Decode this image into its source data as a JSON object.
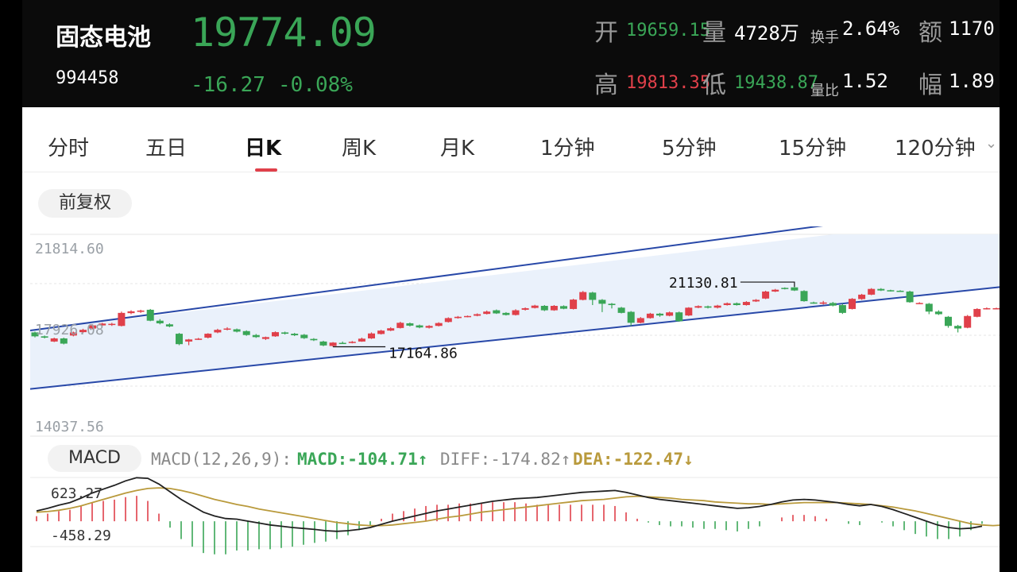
{
  "header": {
    "name": "固态电池",
    "code": "994458",
    "price": "19774.09",
    "change": "-16.27",
    "change_pct": "-0.08%",
    "open_label": "开",
    "open_value": "19659.15",
    "volume_label": "量",
    "volume_value": "4728万",
    "turnover_label": "换手",
    "turnover_value": "2.64%",
    "amount_label": "额",
    "amount_value": "1170",
    "high_label": "高",
    "high_value": "19813.35",
    "low_label": "低",
    "low_value": "19438.87",
    "vol_ratio_label": "量比",
    "vol_ratio_value": "1.52",
    "amplitude_label": "幅",
    "amplitude_value": "1.89"
  },
  "tabs": [
    "分时",
    "五日",
    "日K",
    "周K",
    "月K",
    "1分钟",
    "5分钟",
    "15分钟",
    "120分钟"
  ],
  "active_tab": "日K",
  "adjust_label": "前复权",
  "colors": {
    "up": "#e0404a",
    "down": "#3aa657",
    "channel": "#2848a8",
    "channel_fill": "#eaf1fb",
    "dea": "#b99a3c",
    "diff": "#222222"
  },
  "chart_data": {
    "type": "candlestick",
    "y_ticks": [
      "21814.60",
      "17926.08",
      "14037.56"
    ],
    "ylim": [
      14037.56,
      21814.6
    ],
    "annotations": [
      {
        "label": "21130.81",
        "kind": "high"
      },
      {
        "label": "17164.86",
        "kind": "low"
      }
    ],
    "channel": {
      "upper": [
        [
          0,
          18150
        ],
        [
          83,
          22200
        ]
      ],
      "lower": [
        [
          0,
          15900
        ],
        [
          98,
          19700
        ]
      ]
    },
    "candles": [
      [
        18050,
        17900,
        18080,
        17860
      ],
      [
        17900,
        17850,
        17930,
        17820
      ],
      [
        17700,
        17820,
        17850,
        17680
      ],
      [
        17820,
        17620,
        17850,
        17590
      ],
      [
        17930,
        18050,
        18080,
        17900
      ],
      [
        18060,
        18150,
        18190,
        18030
      ],
      [
        18200,
        18320,
        18360,
        18170
      ],
      [
        18320,
        18390,
        18420,
        18290
      ],
      [
        18350,
        18380,
        18420,
        18300
      ],
      [
        18300,
        18800,
        18850,
        18280
      ],
      [
        18790,
        18860,
        18900,
        18750
      ],
      [
        18840,
        18890,
        18920,
        18800
      ],
      [
        18920,
        18500,
        18950,
        18480
      ],
      [
        18500,
        18400,
        18560,
        18360
      ],
      [
        18360,
        18280,
        18400,
        18250
      ],
      [
        18000,
        17600,
        18030,
        17560
      ],
      [
        17700,
        17780,
        17800,
        17560
      ],
      [
        17780,
        17810,
        17840,
        17760
      ],
      [
        17850,
        18000,
        18020,
        17820
      ],
      [
        18050,
        18150,
        18190,
        18020
      ],
      [
        18160,
        18200,
        18250,
        18130
      ],
      [
        18170,
        18080,
        18200,
        18050
      ],
      [
        18100,
        17950,
        18130,
        17920
      ],
      [
        17950,
        17870,
        17990,
        17840
      ],
      [
        17800,
        17870,
        17890,
        17760
      ],
      [
        17900,
        18060,
        18090,
        17880
      ],
      [
        18050,
        18000,
        18080,
        17970
      ],
      [
        18000,
        17940,
        18030,
        17910
      ],
      [
        17960,
        17830,
        17990,
        17800
      ],
      [
        17800,
        17750,
        17830,
        17720
      ],
      [
        17700,
        17550,
        17730,
        17520
      ],
      [
        17530,
        17660,
        17680,
        17500
      ],
      [
        17650,
        17640,
        17700,
        17620
      ],
      [
        17660,
        17690,
        17720,
        17630
      ],
      [
        17700,
        17810,
        17850,
        17690
      ],
      [
        17820,
        18010,
        18050,
        17800
      ],
      [
        17990,
        18120,
        18150,
        17970
      ],
      [
        18120,
        18210,
        18250,
        18100
      ],
      [
        18220,
        18420,
        18460,
        18200
      ],
      [
        18400,
        18310,
        18430,
        18280
      ],
      [
        18320,
        18240,
        18350,
        18210
      ],
      [
        18230,
        18300,
        18330,
        18200
      ],
      [
        18300,
        18410,
        18440,
        18280
      ],
      [
        18450,
        18600,
        18630,
        18430
      ],
      [
        18600,
        18650,
        18680,
        18580
      ],
      [
        18660,
        18680,
        18700,
        18630
      ],
      [
        18690,
        18750,
        18780,
        18670
      ],
      [
        18760,
        18850,
        18890,
        18740
      ],
      [
        18900,
        18780,
        18930,
        18760
      ],
      [
        18800,
        18720,
        18830,
        18700
      ],
      [
        18720,
        18900,
        18940,
        18700
      ],
      [
        18920,
        18980,
        19010,
        18890
      ],
      [
        18990,
        19080,
        19110,
        18970
      ],
      [
        19070,
        18900,
        19100,
        18870
      ],
      [
        18900,
        19070,
        19100,
        18880
      ],
      [
        19060,
        18960,
        19090,
        18940
      ],
      [
        18950,
        19310,
        19340,
        18930
      ],
      [
        19300,
        19600,
        19640,
        19280
      ],
      [
        19580,
        19300,
        19610,
        19100
      ],
      [
        19300,
        19150,
        19330,
        18830
      ],
      [
        19150,
        19100,
        19180,
        18970
      ],
      [
        19000,
        18800,
        19030,
        18780
      ],
      [
        18840,
        18420,
        18870,
        18300
      ],
      [
        18420,
        18600,
        18640,
        18400
      ],
      [
        18600,
        18770,
        18800,
        18580
      ],
      [
        18770,
        18700,
        18800,
        18650
      ],
      [
        18690,
        18820,
        18850,
        18670
      ],
      [
        18820,
        18480,
        18850,
        18460
      ],
      [
        18700,
        19000,
        19020,
        18680
      ],
      [
        19000,
        19060,
        19090,
        18980
      ],
      [
        19050,
        19000,
        19080,
        18970
      ],
      [
        19000,
        19080,
        19110,
        18970
      ],
      [
        19100,
        19170,
        19200,
        19080
      ],
      [
        19170,
        19100,
        19200,
        19080
      ],
      [
        19100,
        19220,
        19250,
        19080
      ],
      [
        19240,
        19300,
        19330,
        19220
      ],
      [
        19350,
        19620,
        19650,
        19330
      ],
      [
        19620,
        19690,
        19720,
        19600
      ],
      [
        19760,
        19740,
        19780,
        19700
      ],
      [
        19780,
        19660,
        19800,
        19640
      ],
      [
        19640,
        19250,
        19670,
        19230
      ],
      [
        19200,
        19180,
        19230,
        19150
      ],
      [
        19150,
        19200,
        19260,
        19120
      ],
      [
        19180,
        19080,
        19220,
        19050
      ],
      [
        19100,
        18800,
        19150,
        18760
      ],
      [
        18950,
        19340,
        19370,
        18930
      ],
      [
        19330,
        19500,
        19530,
        19300
      ],
      [
        19500,
        19720,
        19750,
        19480
      ],
      [
        19720,
        19660,
        19750,
        19640
      ],
      [
        19670,
        19650,
        19690,
        19620
      ],
      [
        19650,
        19630,
        19670,
        19610
      ],
      [
        19620,
        19210,
        19650,
        19190
      ],
      [
        19180,
        19180,
        19210,
        19150
      ],
      [
        19150,
        18850,
        19180,
        18750
      ],
      [
        18850,
        18750,
        18900,
        18720
      ],
      [
        18650,
        18300,
        18680,
        18230
      ],
      [
        18300,
        18200,
        18340,
        18050
      ],
      [
        18230,
        18680,
        18720,
        18210
      ],
      [
        18650,
        18950,
        18980,
        18630
      ],
      [
        18950,
        18980,
        19010,
        18930
      ],
      [
        18960,
        18980,
        19000,
        18940
      ]
    ]
  },
  "macd": {
    "label": "MACD",
    "params": "MACD(12,26,9):",
    "macd_text": "MACD:-104.71↑",
    "diff_text": "DIFF:-174.82↑",
    "dea_text": "DEA:-122.47↓",
    "y_top": "623.27",
    "y_bottom": "-458.29",
    "diff": [
      100,
      140,
      190,
      230,
      300,
      380,
      440,
      500,
      570,
      620,
      610,
      520,
      400,
      280,
      180,
      80,
      20,
      -20,
      -30,
      -60,
      -90,
      -120,
      -140,
      -160,
      -175,
      -190,
      -210,
      -220,
      -210,
      -190,
      -160,
      -110,
      -60,
      -20,
      20,
      60,
      100,
      130,
      160,
      190,
      220,
      250,
      270,
      290,
      300,
      310,
      330,
      350,
      370,
      390,
      400,
      410,
      420,
      390,
      350,
      310,
      280,
      260,
      240,
      220,
      200,
      180,
      160,
      140,
      150,
      170,
      200,
      240,
      270,
      280,
      270,
      250,
      230,
      200,
      180,
      200,
      170,
      120,
      60,
      0,
      -60,
      -120,
      -160,
      -180,
      -170,
      -140
    ],
    "dea": [
      80,
      90,
      110,
      140,
      180,
      230,
      280,
      330,
      380,
      420,
      450,
      460,
      450,
      420,
      380,
      330,
      280,
      240,
      200,
      170,
      130,
      100,
      70,
      40,
      10,
      -20,
      -50,
      -80,
      -100,
      -120,
      -130,
      -130,
      -120,
      -100,
      -80,
      -60,
      -30,
      0,
      20,
      50,
      80,
      100,
      120,
      140,
      160,
      180,
      200,
      220,
      240,
      260,
      270,
      280,
      300,
      320,
      330,
      320,
      310,
      300,
      280,
      270,
      260,
      240,
      230,
      220,
      210,
      210,
      200,
      210,
      220,
      230,
      230,
      230,
      230,
      220,
      210,
      200,
      180,
      160,
      130,
      100,
      60,
      20,
      -20,
      -60,
      -100,
      -120,
      -130,
      -120
    ],
    "hist": [
      40,
      60,
      80,
      90,
      120,
      150,
      160,
      170,
      190,
      200,
      160,
      60,
      -50,
      -140,
      -200,
      -250,
      -260,
      -260,
      -230,
      -230,
      -220,
      -220,
      -210,
      -200,
      -185,
      -170,
      -160,
      -140,
      -110,
      -70,
      -30,
      20,
      60,
      80,
      100,
      120,
      130,
      130,
      140,
      140,
      140,
      150,
      150,
      150,
      140,
      130,
      130,
      130,
      130,
      130,
      130,
      130,
      120,
      70,
      20,
      -10,
      -30,
      -40,
      -40,
      -50,
      -60,
      -60,
      -70,
      -80,
      -60,
      -40,
      0,
      30,
      50,
      50,
      40,
      20,
      0,
      -20,
      -30,
      0,
      -10,
      -40,
      -70,
      -100,
      -120,
      -140,
      -140,
      -120,
      -70,
      -20
    ]
  }
}
